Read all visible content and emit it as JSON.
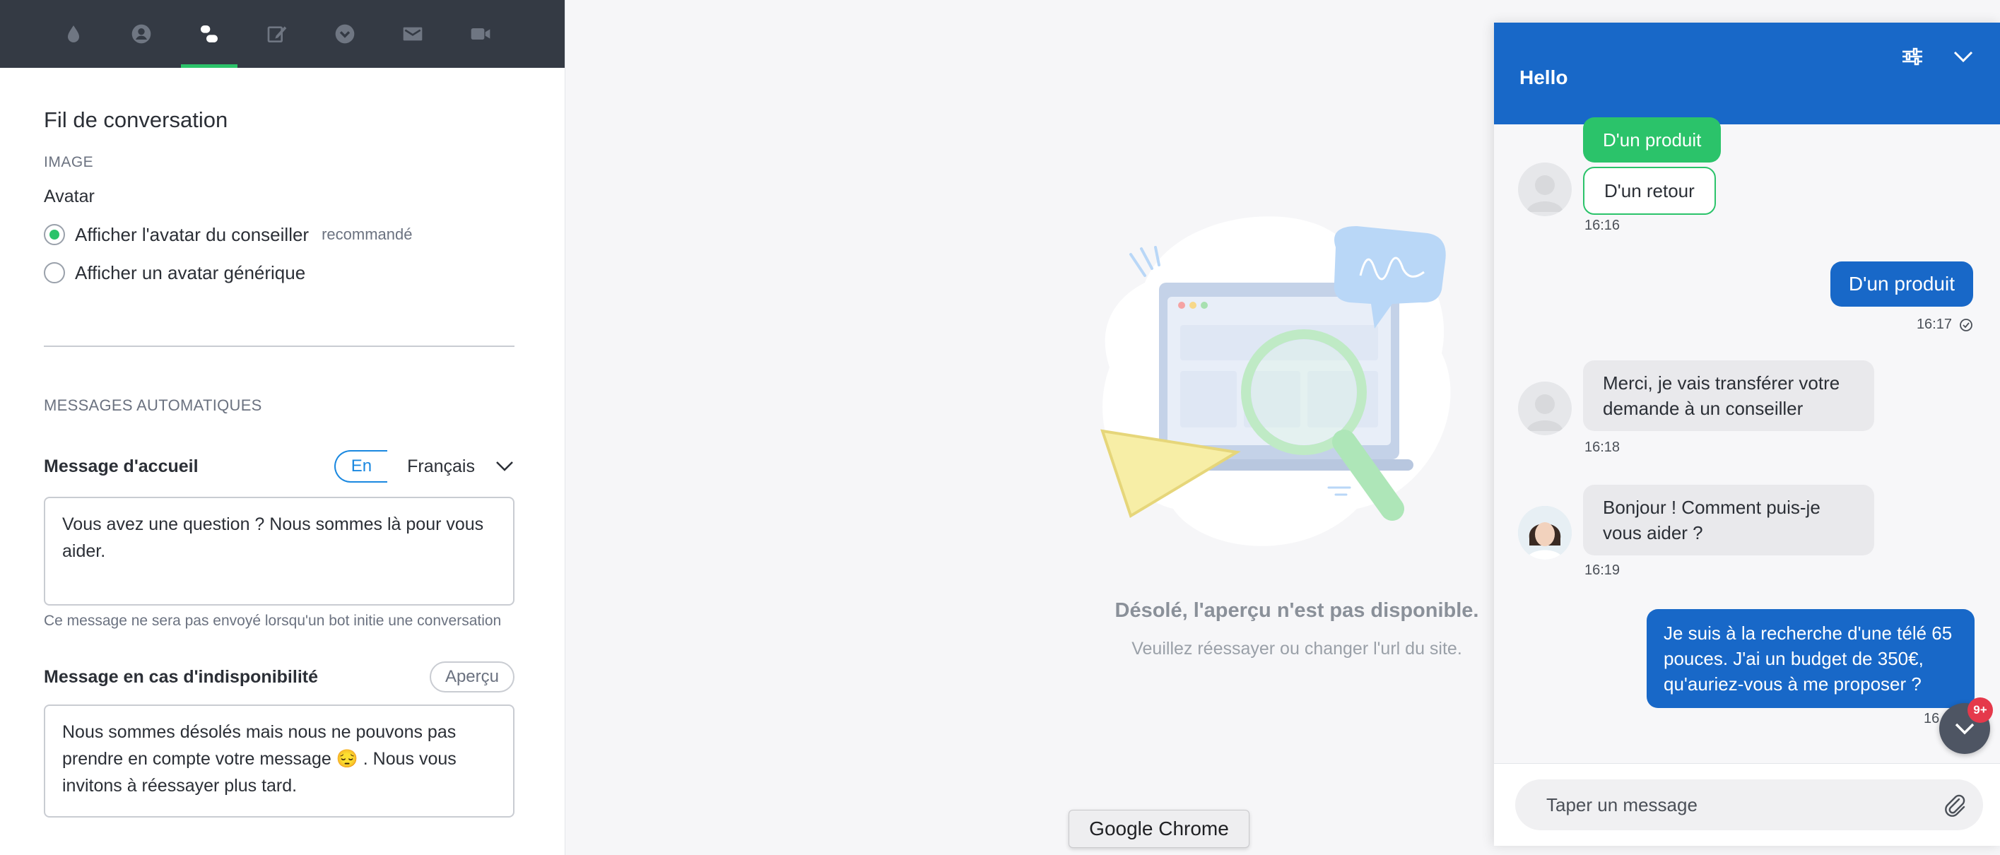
{
  "topbar": {
    "tabs": [
      {
        "name": "drop-icon",
        "active": false
      },
      {
        "name": "user-icon",
        "active": false
      },
      {
        "name": "chat-thread-icon",
        "active": true
      },
      {
        "name": "pencil-icon",
        "active": false
      },
      {
        "name": "chevron-circle-icon",
        "active": false
      },
      {
        "name": "mail-icon",
        "active": false
      },
      {
        "name": "video-icon",
        "active": false
      }
    ]
  },
  "panel": {
    "title": "Fil de conversation",
    "image_section": "IMAGE",
    "avatar_heading": "Avatar",
    "avatar_options": [
      {
        "label": "Afficher l'avatar du conseiller",
        "tag": "recommandé",
        "selected": true
      },
      {
        "label": "Afficher un avatar générique",
        "tag": "",
        "selected": false
      }
    ],
    "auto_section": "MESSAGES AUTOMATIQUES",
    "welcome": {
      "title": "Message d'accueil",
      "lang_pill": "En",
      "lang_select": "Français",
      "value": "Vous avez une question ? Nous sommes là pour vous aider.",
      "help": "Ce message ne sera pas envoyé lorsqu'un bot initie une conversation"
    },
    "unavailable": {
      "title": "Message en cas d'indisponibilité",
      "preview_button": "Aperçu",
      "value": "Nous sommes désolés mais nous ne pouvons pas prendre en compte votre message 😔 . Nous vous invitons à réessayer plus tard."
    }
  },
  "center": {
    "error_title": "Désolé, l'aperçu n'est pas disponible.",
    "error_sub": "Veuillez réessayer ou changer l'url du site."
  },
  "tooltip": "Google Chrome",
  "chat": {
    "title": "Hello",
    "choice_selected": "D'un produit",
    "choice_other": "D'un retour",
    "time_choices": "16:16",
    "user_msg1": "D'un produit",
    "time_user1": "16:17",
    "bot_msg1": "Merci, je vais transférer votre demande à un conseiller",
    "time_bot1": "16:18",
    "agent_msg": "Bonjour ! Comment puis-je vous aider ?",
    "time_agent": "16:19",
    "user_msg2": "Je suis à la recherche d'une télé 65 pouces. J'ai un budget de 350€, qu'auriez-vous à me proposer ?",
    "time_user2": "16",
    "badge": "9+",
    "input_placeholder": "Taper un message"
  },
  "colors": {
    "accent_green": "#2bc36a",
    "chat_blue": "#1868c8",
    "topbar": "#343a44",
    "lang_blue": "#1a88e0"
  }
}
